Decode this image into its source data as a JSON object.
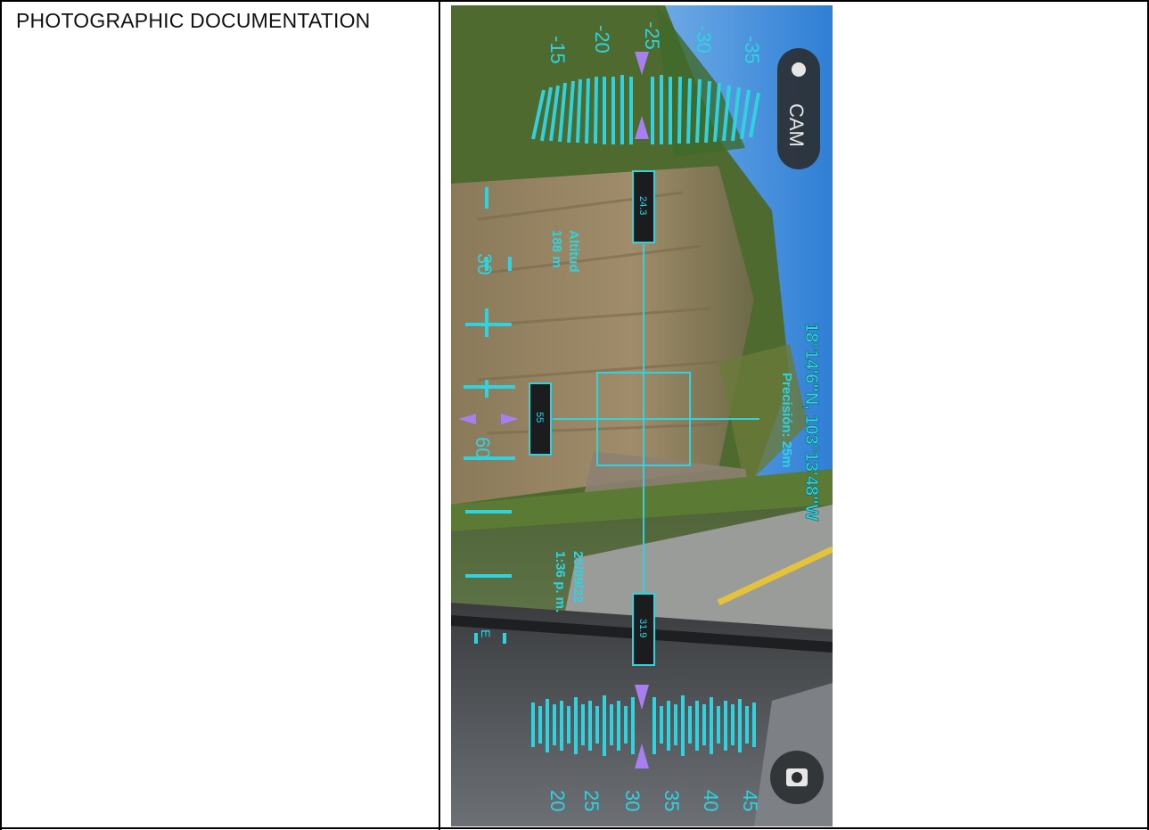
{
  "document": {
    "section_label": "PHOTOGRAPHIC DOCUMENTATION"
  },
  "photo": {
    "coordinates": "18°14'6\"N, 103°13'48\"W",
    "precision": "Precisión: 25m",
    "altitude_label": "Altitud",
    "altitude_value": "188 m",
    "date": "25/09/22",
    "time": "1:36 p. m.",
    "cam_button": "CAM",
    "top_box_value": "24.3",
    "bottom_box_value": "31.9",
    "left_box_value": "55",
    "compass_letter": "E",
    "left_scale_ticks": [
      "30",
      "60"
    ],
    "top_scale_ticks": [
      "-15",
      "-20",
      "-25",
      "-30",
      "-35"
    ],
    "bottom_scale_ticks": [
      "20",
      "25",
      "30",
      "35",
      "40",
      "45"
    ],
    "colors": {
      "hud": "#2fd3e0",
      "marker": "#a77ff0",
      "sky": "#3f8fd8",
      "road": "#8a8f94"
    }
  }
}
